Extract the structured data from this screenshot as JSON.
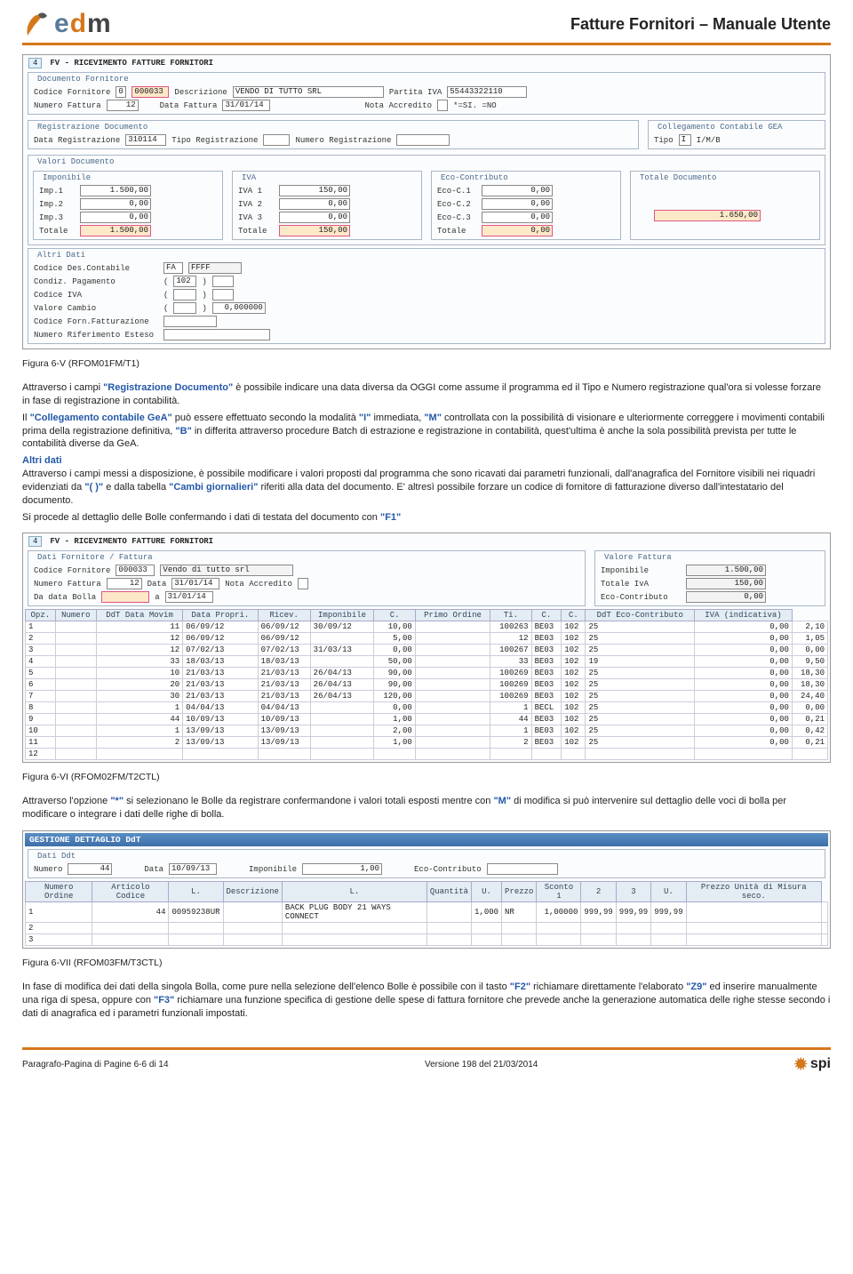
{
  "header": {
    "doc_title": "Fatture Fornitori – Manuale Utente",
    "logo_e": "e",
    "logo_d": "d",
    "logo_m": "m"
  },
  "ss1": {
    "tab": "4",
    "title": "FV - RICEVIMENTO FATTURE FORNITORI",
    "grp_doc": "Documento Fornitore",
    "cod_forn_lbl": "Codice Fornitore",
    "cod_forn_mark": "0",
    "cod_forn": "000033",
    "desc_lbl": "Descrizione",
    "desc": "VENDO DI TUTTO SRL",
    "piva_lbl": "Partita IVA",
    "piva": "55443322110",
    "num_fatt_lbl": "Numero Fattura",
    "num_fatt": "12",
    "data_fatt_lbl": "Data Fattura",
    "data_fatt": "31/01/14",
    "nota_lbl": "Nota Accredito",
    "nota": "*=SI.  =NO",
    "grp_reg": "Registrazione Documento",
    "data_reg_lbl": "Data Registrazione",
    "data_reg": "310114",
    "tipo_reg_lbl": "Tipo Registrazione",
    "num_reg_lbl": "Numero Registrazione",
    "grp_gea": "Collegamento Contabile GEA",
    "tipo_lbl": "Tipo",
    "tipo": "I",
    "tipo_hint": "I/M/B",
    "grp_val": "Valori Documento",
    "grp_imp": "Imponibile",
    "grp_iva": "IVA",
    "grp_eco": "Eco-Contributo",
    "grp_tot": "Totale Documento",
    "imp1_lbl": "Imp.1",
    "imp1": "1.500,00",
    "imp2_lbl": "Imp.2",
    "imp2": "0,00",
    "imp3_lbl": "Imp.3",
    "imp3": "0,00",
    "imp_tot_lbl": "Totale",
    "imp_tot": "1.500,00",
    "iva1_lbl": "IVA 1",
    "iva1": "150,00",
    "iva2_lbl": "IVA 2",
    "iva2": "0,00",
    "iva3_lbl": "IVA 3",
    "iva3": "0,00",
    "iva_tot_lbl": "Totale",
    "iva_tot": "150,00",
    "eco1_lbl": "Eco-C.1",
    "eco1": "0,00",
    "eco2_lbl": "Eco-C.2",
    "eco2": "0,00",
    "eco3_lbl": "Eco-C.3",
    "eco3": "0,00",
    "eco_tot_lbl": "Totale",
    "eco_tot": "0,00",
    "totale": "1.650,00",
    "grp_altri": "Altri Dati",
    "a1_lbl": "Codice Des.Contabile",
    "a1a": "FA",
    "a1b": "FFFF",
    "a2_lbl": "Condiz. Pagamento",
    "a2": "102",
    "a3_lbl": "Codice IVA",
    "a4_lbl": "Valore Cambio",
    "a4": "0,000000",
    "a5_lbl": "Codice Forn.Fatturazione",
    "a6_lbl": "Numero Riferimento Esteso"
  },
  "cap1": "Figura 6-V  (RFOM01FM/T1)",
  "p1a": "Attraverso i campi ",
  "p1b": "\"Registrazione Documento\"",
  "p1c": " è possibile indicare una data diversa da OGGI come assume il programma ed il Tipo e Numero registrazione  qual'ora si volesse forzare in fase di registrazione in contabilità.",
  "p2a": "Il ",
  "p2b": "\"Collegamento contabile GeA\"",
  "p2c": "  può essere effettuato secondo la modalità ",
  "p2d": "\"I\"",
  "p2e": " immediata, ",
  "p2f": "\"M\"",
  "p2g": " controllata con la possibilità di visionare e ulteriormente correggere i movimenti contabili prima della registrazione definitiva, ",
  "p2h": "\"B\"",
  "p2i": " in differita attraverso procedure Batch di estrazione e registrazione in contabilità, quest'ultima è anche la sola possibilità prevista per tutte le contabilità diverse da GeA.",
  "p3a": "Altri dati",
  "p3b": "Attraverso i campi messi a disposizione, è possibile modificare i valori proposti dal programma che sono ricavati dai parametri funzionali, dall'anagrafica del Fornitore visibili nei riquadri evidenziati da ",
  "p3c": "\"(  )\"",
  "p3d": " e dalla tabella ",
  "p3e": "\"Cambi giornalieri\"",
  "p3f": " riferiti alla data del documento. E' altresì possibile forzare un codice di fornitore di fatturazione diverso dall'intestatario del documento.",
  "p4a": "Si procede al dettaglio delle Bolle confermando i dati di testata del documento con ",
  "p4b": "\"F1\"",
  "ss2": {
    "tab": "4",
    "title": "FV - RICEVIMENTO FATTURE FORNITORI",
    "grp_a": "Dati Fornitore / Fattura",
    "grp_b": "Valore Fattura",
    "cf_lbl": "Codice Fornitore",
    "cf": "000033",
    "cf_desc": "Vendo di tutto srl",
    "nf_lbl": "Numero Fattura",
    "nf": "12",
    "data_lbl": "Data",
    "data": "31/01/14",
    "na_lbl": "Nota Accredito",
    "dd_lbl": "Da data Bolla",
    "dd_a": "a",
    "dd_v": "31/01/14",
    "imp_lbl": "Imponibile",
    "imp": "1.500,00",
    "tiva_lbl": "Totale IvA",
    "tiva": "150,00",
    "eco_lbl": "Eco-Contributo",
    "eco": "0,00",
    "cols": [
      "Opz.",
      "Numero",
      "DdT Data Movim",
      "Data Propri.",
      "Ricev.",
      "Imponibile",
      "C.",
      "Primo Ordine",
      "Ti.",
      "C.",
      "C.",
      "DdT Eco-Contributo",
      "IVA (indicativa)"
    ],
    "rows": [
      [
        "1",
        "",
        "11",
        "06/09/12",
        "06/09/12",
        "30/09/12",
        "10,00",
        "",
        "100263",
        "BE03",
        "102",
        "25",
        "0,00",
        "2,10"
      ],
      [
        "2",
        "",
        "12",
        "06/09/12",
        "06/09/12",
        "",
        "5,00",
        "",
        "12",
        "BE03",
        "102",
        "25",
        "0,00",
        "1,05"
      ],
      [
        "3",
        "",
        "12",
        "07/02/13",
        "07/02/13",
        "31/03/13",
        "0,00",
        "",
        "100267",
        "BE03",
        "102",
        "25",
        "0,00",
        "0,00"
      ],
      [
        "4",
        "",
        "33",
        "18/03/13",
        "18/03/13",
        "",
        "50,00",
        "",
        "33",
        "BE03",
        "102",
        "19",
        "0,00",
        "9,50"
      ],
      [
        "5",
        "",
        "10",
        "21/03/13",
        "21/03/13",
        "26/04/13",
        "90,00",
        "",
        "100269",
        "BE03",
        "102",
        "25",
        "0,00",
        "18,30"
      ],
      [
        "6",
        "",
        "20",
        "21/03/13",
        "21/03/13",
        "26/04/13",
        "90,00",
        "",
        "100269",
        "BE03",
        "102",
        "25",
        "0,00",
        "18,30"
      ],
      [
        "7",
        "",
        "30",
        "21/03/13",
        "21/03/13",
        "26/04/13",
        "120,00",
        "",
        "100269",
        "BE03",
        "102",
        "25",
        "0,00",
        "24,40"
      ],
      [
        "8",
        "",
        "1",
        "04/04/13",
        "04/04/13",
        "",
        "0,00",
        "",
        "1",
        "BECL",
        "102",
        "25",
        "0,00",
        "0,00"
      ],
      [
        "9",
        "",
        "44",
        "10/09/13",
        "10/09/13",
        "",
        "1,00",
        "",
        "44",
        "BE03",
        "102",
        "25",
        "0,00",
        "0,21"
      ],
      [
        "10",
        "",
        "1",
        "13/09/13",
        "13/09/13",
        "",
        "2,00",
        "",
        "1",
        "BE03",
        "102",
        "25",
        "0,00",
        "0,42"
      ],
      [
        "11",
        "",
        "2",
        "13/09/13",
        "13/09/13",
        "",
        "1,00",
        "",
        "2",
        "BE03",
        "102",
        "25",
        "0,00",
        "0,21"
      ],
      [
        "12",
        "",
        "",
        "",
        "",
        "",
        "",
        "",
        "",
        "",
        "",
        "",
        "",
        ""
      ]
    ]
  },
  "cap2": "Figura 6-VI  (RFOM02FM/T2CTL)",
  "p5a": "Attraverso l'opzione ",
  "p5b": "\"*\"",
  "p5c": " si selezionano le Bolle da registrare confermandone i valori totali esposti mentre con ",
  "p5d": "\"M\"",
  "p5e": " di modifica si può intervenire sul dettaglio delle voci di bolla per modificare o integrare i dati delle righe di bolla.",
  "ss3": {
    "title": "GESTIONE DETTAGLIO DdT",
    "grp": "Dati Ddt",
    "num_lbl": "Numero",
    "num": "44",
    "data_lbl": "Data",
    "data": "10/09/13",
    "imp_lbl": "Imponibile",
    "imp": "1,00",
    "eco_lbl": "Eco-Contributo",
    "cols": [
      "Numero Ordine",
      "Articolo Codice",
      "L.",
      "Descrizione",
      "L.",
      "Quantità",
      "U.",
      "Prezzo",
      "Sconto 1",
      "2",
      "3",
      "U.",
      "Prezzo Unità di Misura seco."
    ],
    "rows": [
      [
        "1",
        "44",
        "00959238UR",
        "",
        "BACK PLUG BODY 21 WAYS CONNECT",
        "",
        "1,000",
        "NR",
        "1,00000",
        "999,99",
        "999,99",
        "999,99",
        "",
        ""
      ],
      [
        "2",
        "",
        "",
        "",
        "",
        "",
        "",
        "",
        "",
        "",
        "",
        "",
        "",
        ""
      ],
      [
        "3",
        "",
        "",
        "",
        "",
        "",
        "",
        "",
        "",
        "",
        "",
        "",
        "",
        ""
      ]
    ]
  },
  "cap3": "Figura 6-VII  (RFOM03FM/T3CTL)",
  "p6a": "In fase di modifica dei dati della singola Bolla, come pure nella selezione dell'elenco Bolle è possibile con il tasto ",
  "p6b": "\"F2\"",
  "p6c": " richiamare direttamente l'elaborato ",
  "p6d": "\"Z9\"",
  "p6e": " ed inserire manualmente una riga di spesa, oppure con ",
  "p6f": "\"F3\"",
  "p6g": " richiamare una funzione specifica di gestione delle spese di fattura fornitore che prevede anche la generazione automatica delle righe stesse secondo i dati di anagrafica ed i parametri funzionali impostati.",
  "footer": {
    "left": "Paragrafo-Pagina di Pagine 6-6 di 14",
    "mid": "Versione 198 del 21/03/2014",
    "logo": "spi"
  }
}
